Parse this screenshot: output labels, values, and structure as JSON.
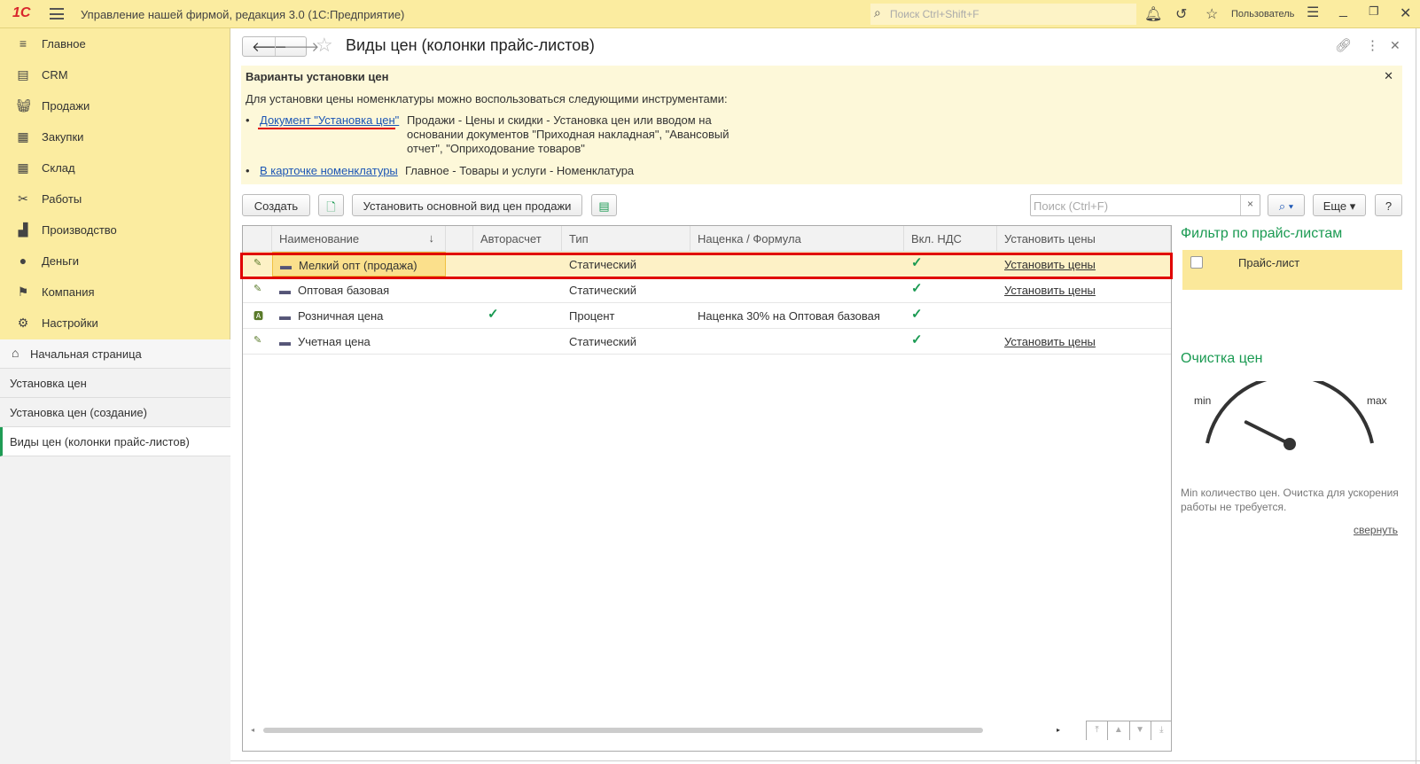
{
  "app": {
    "title": "Управление нашей фирмой, редакция 3.0  (1С:Предприятие)",
    "logo": "1С",
    "search_placeholder": "Поиск Ctrl+Shift+F",
    "user": "Пользователь"
  },
  "sidebar": {
    "items": [
      {
        "label": "Главное",
        "icon": "menu-icon"
      },
      {
        "label": "CRM",
        "icon": "crm-icon"
      },
      {
        "label": "Продажи",
        "icon": "basket-icon"
      },
      {
        "label": "Закупки",
        "icon": "purchases-icon"
      },
      {
        "label": "Склад",
        "icon": "warehouse-icon"
      },
      {
        "label": "Работы",
        "icon": "tools-icon"
      },
      {
        "label": "Производство",
        "icon": "factory-icon"
      },
      {
        "label": "Деньги",
        "icon": "money-icon"
      },
      {
        "label": "Компания",
        "icon": "flag-icon"
      },
      {
        "label": "Настройки",
        "icon": "gear-icon"
      }
    ],
    "open_windows": [
      "Начальная страница",
      "Установка цен",
      "Установка цен (создание)",
      "Виды цен (колонки прайс-листов)"
    ]
  },
  "page": {
    "title": "Виды цен (колонки прайс-листов)"
  },
  "info": {
    "title": "Варианты установки цен",
    "intro": "Для установки цены номенклатуры можно воспользоваться следующими инструментами:",
    "items": [
      {
        "link": "Документ \"Установка цен\"",
        "text": "Продажи - Цены и скидки - Установка цен или вводом на основании документов \"Приходная накладная\", \"Авансовый отчет\", \"Оприходование товаров\""
      },
      {
        "link": "В карточке номенклатуры",
        "text": "Главное - Товары и услуги - Номенклатура"
      }
    ]
  },
  "toolbar": {
    "create": "Создать",
    "set_main": "Установить основной вид цен продажи",
    "search_placeholder": "Поиск (Ctrl+F)",
    "more": "Еще",
    "help": "?",
    "clear": "×"
  },
  "table": {
    "columns": [
      "Наименование",
      "",
      "Авторасчет",
      "Тип",
      "Наценка / Формула",
      "Вкл. НДС",
      "Установить цены"
    ],
    "rows": [
      {
        "name": "Мелкий опт (продажа)",
        "auto": false,
        "type": "Статический",
        "formula": "",
        "vat": true,
        "set": "Установить цены",
        "selected": true
      },
      {
        "name": "Оптовая базовая",
        "auto": false,
        "type": "Статический",
        "formula": "",
        "vat": true,
        "set": "Установить цены"
      },
      {
        "name": "Розничная цена",
        "auto": true,
        "type": "Процент",
        "formula": "Наценка 30% на Оптовая базовая",
        "vat": true,
        "set": ""
      },
      {
        "name": "Учетная цена",
        "auto": false,
        "type": "Статический",
        "formula": "",
        "vat": true,
        "set": "Установить цены"
      }
    ]
  },
  "filter": {
    "title": "Фильтр по прайс-листам",
    "column": "Прайс-лист"
  },
  "cleanup": {
    "title": "Очистка цен",
    "min": "min",
    "max": "max",
    "gauge_level": 0.1,
    "message": "Min количество цен. Очистка для ускорения работы не требуется.",
    "collapse": "свернуть"
  },
  "colors": {
    "accent": "#1a9a52",
    "titlebar": "#fbeca0",
    "highlight": "#e00000"
  }
}
